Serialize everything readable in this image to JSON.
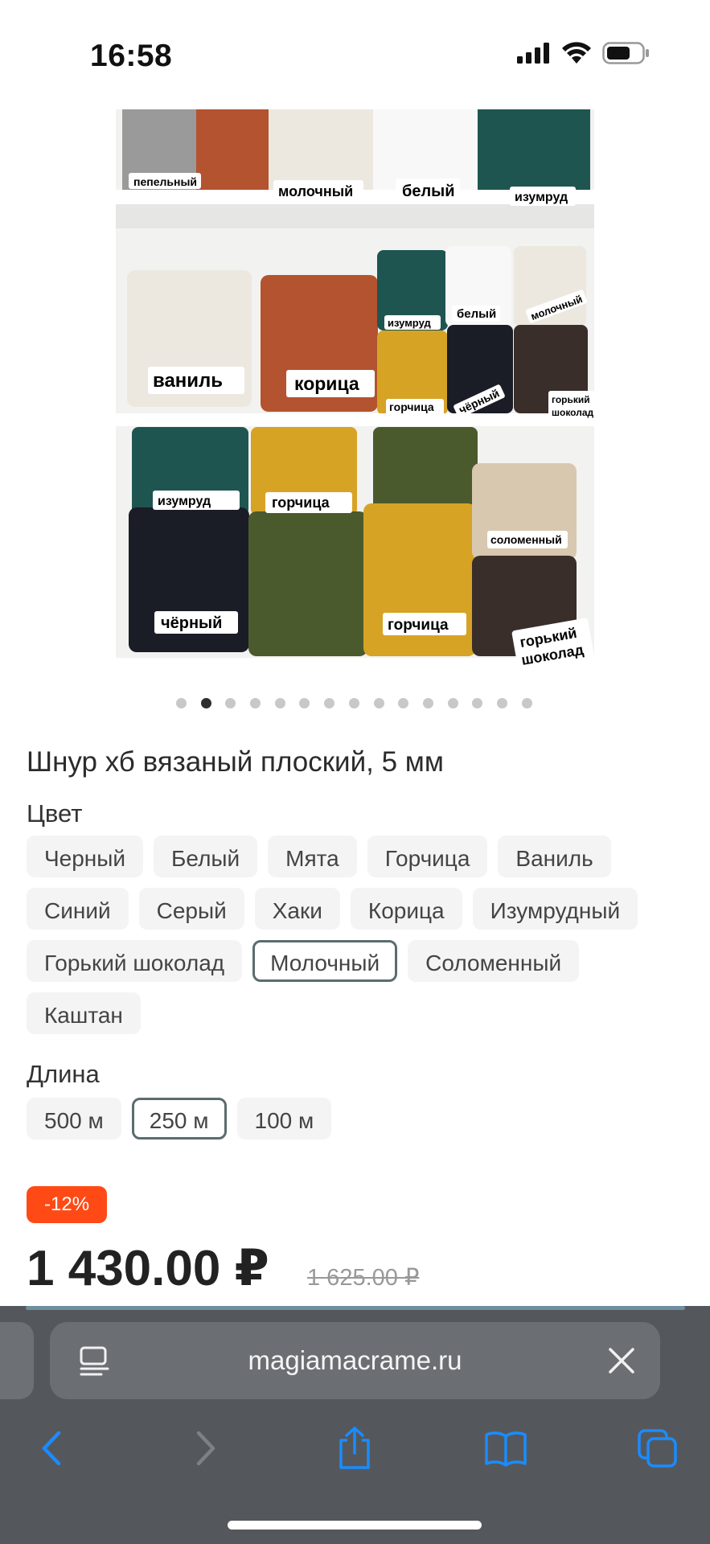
{
  "status_bar": {
    "time": "16:58"
  },
  "product_image": {
    "labels": {
      "top_1": "пепельный",
      "top_2": "молочный",
      "top_3": "белый",
      "top_4": "изумруд",
      "mid_1": "ваниль",
      "mid_2": "корица",
      "mid_3": "изумруд",
      "mid_4": "белый",
      "mid_5": "молочный",
      "mid_6": "горчица",
      "mid_7": "чёрный",
      "mid_8a": "горький",
      "mid_8b": "шоколад",
      "bot_1": "изумруд",
      "bot_2": "горчица",
      "bot_3": "соломенный",
      "bot_4": "чёрный",
      "bot_5": "горчица",
      "bot_6a": "горький",
      "bot_6b": "шоколад"
    },
    "colors": {
      "shelf": "#f2f2f0",
      "rust": "#b4532f",
      "emerald": "#1f5551",
      "mustard": "#d6a325",
      "khaki": "#4a5a2c",
      "black": "#1a1c26",
      "chocolate": "#3a2e2a",
      "cream": "#ece8e0",
      "straw": "#d8c8b0",
      "gray": "#9a9a9a"
    }
  },
  "pager": {
    "count": 15,
    "active_index": 1
  },
  "product": {
    "title": "Шнур хб вязаный плоский, 5 мм",
    "color_label": "Цвет",
    "colors": [
      {
        "label": "Черный",
        "selected": false
      },
      {
        "label": "Белый",
        "selected": false
      },
      {
        "label": "Мята",
        "selected": false
      },
      {
        "label": "Горчица",
        "selected": false
      },
      {
        "label": "Ваниль",
        "selected": false
      },
      {
        "label": "Синий",
        "selected": false
      },
      {
        "label": "Серый",
        "selected": false
      },
      {
        "label": "Хаки",
        "selected": false
      },
      {
        "label": "Корица",
        "selected": false
      },
      {
        "label": "Изумрудный",
        "selected": false
      },
      {
        "label": "Горький шоколад",
        "selected": false
      },
      {
        "label": "Молочный",
        "selected": true
      },
      {
        "label": "Соломенный",
        "selected": false
      },
      {
        "label": "Каштан",
        "selected": false
      }
    ],
    "length_label": "Длина",
    "lengths": [
      {
        "label": "500 м",
        "selected": false
      },
      {
        "label": "250 м",
        "selected": true
      },
      {
        "label": "100 м",
        "selected": false
      }
    ],
    "discount": "-12%",
    "price": "1 430.00 ₽",
    "old_price": "1 625.00 ₽"
  },
  "browser": {
    "url": "magiamacrame.ru",
    "accent": "#1a8cff"
  }
}
